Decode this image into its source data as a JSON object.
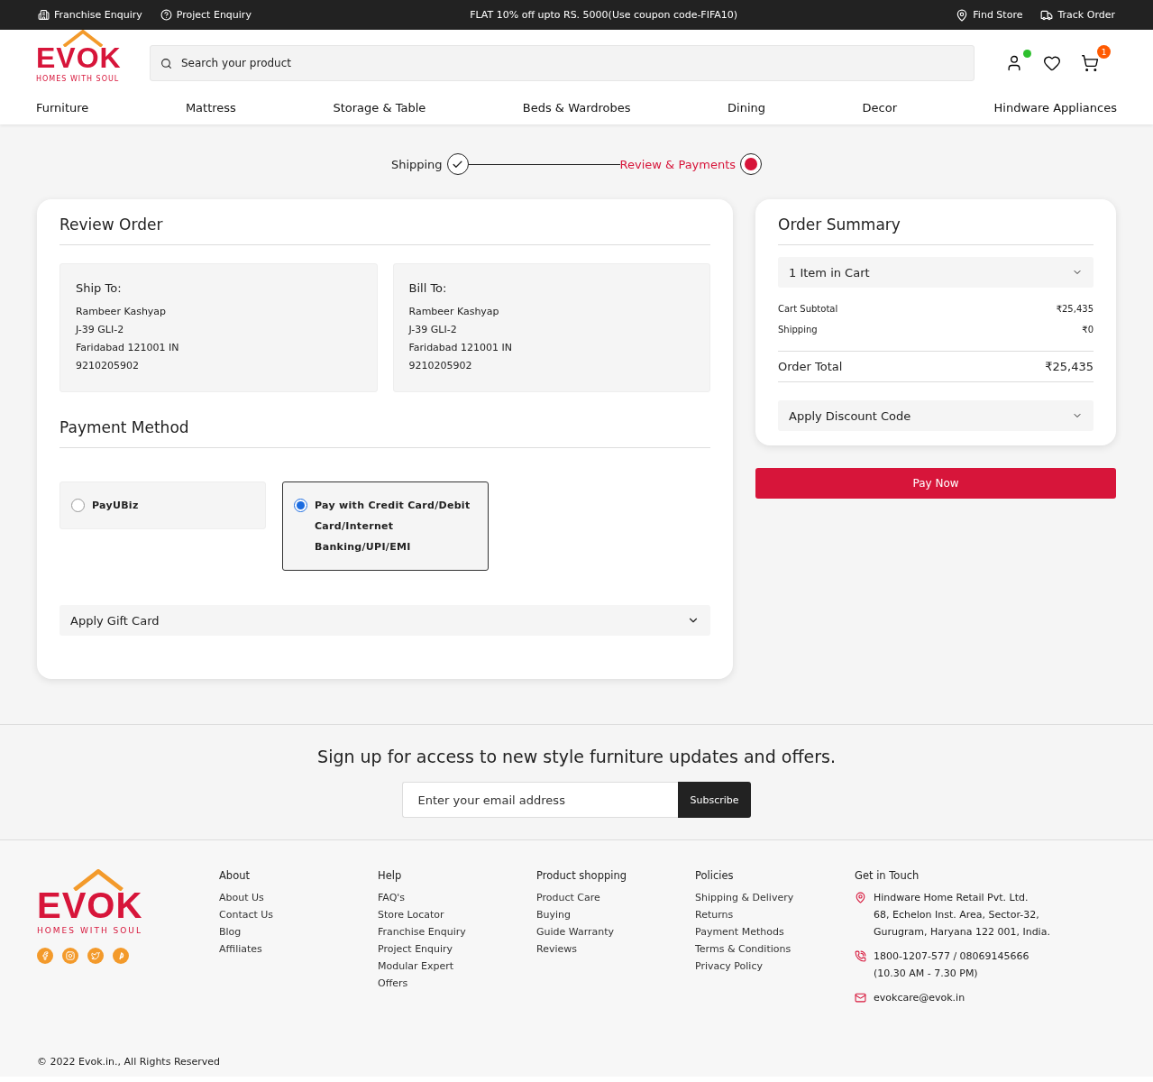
{
  "top_bar": {
    "left_links": [
      "Franchise Enquiry",
      "Project Enquiry"
    ],
    "promo": "FLAT 10% off upto RS. 5000(Use coupon code-FIFA10)",
    "right_links": [
      "Find Store",
      "Track Order"
    ]
  },
  "header": {
    "logo": {
      "name": "EVOK",
      "tagline": "HOMES WITH SOUL"
    },
    "search": {
      "placeholder": "Search your product"
    },
    "account_online": true,
    "cart_count": "1"
  },
  "nav": [
    "Furniture",
    "Mattress",
    "Storage & Table",
    "Beds & Wardrobes",
    "Dining",
    "Decor",
    "Hindware Appliances"
  ],
  "steps": [
    {
      "label": "Shipping",
      "done": true,
      "current": false
    },
    {
      "label": "Review & Payments",
      "done": false,
      "current": true
    }
  ],
  "review": {
    "title": "Review Order",
    "addresses": [
      {
        "title": "Ship To:",
        "lines": [
          "Rambeer Kashyap",
          "J-39 GLI-2",
          "Faridabad 121001 IN",
          "9210205902"
        ]
      },
      {
        "title": "Bill To:",
        "lines": [
          "Rambeer Kashyap",
          "J-39 GLI-2",
          "Faridabad 121001 IN",
          "9210205902"
        ]
      }
    ],
    "payment_title": "Payment Method",
    "payment_options": [
      {
        "label": "PayUBiz",
        "selected": false
      },
      {
        "label": "Pay with Credit Card/Debit Card/Internet Banking/UPI/EMI",
        "selected": true
      }
    ],
    "gift_card": {
      "label": "Apply Gift Card",
      "expanded": false
    }
  },
  "summary": {
    "title": "Order Summary",
    "cart_toggle": {
      "label": "1 Item in Cart",
      "expanded": false
    },
    "rows": [
      {
        "label": "Cart Subtotal",
        "value": "₹25,435"
      },
      {
        "label": "Shipping",
        "value": "₹0"
      }
    ],
    "total": {
      "label": "Order Total",
      "value": "₹25,435"
    },
    "discount": {
      "label": "Apply Discount Code",
      "expanded": false
    },
    "pay_button": "Pay Now"
  },
  "signup": {
    "title": "Sign up for access to new style furniture updates and offers.",
    "placeholder": "Enter your email address",
    "button": "Subscribe"
  },
  "footer": {
    "logo": {
      "name": "EVOK",
      "tagline": "HOMES WITH SOUL"
    },
    "columns": [
      {
        "title": "About",
        "links": [
          "About Us",
          "Contact Us",
          "Blog",
          "Affiliates"
        ]
      },
      {
        "title": "Help",
        "links": [
          "FAQ's",
          "Store Locator",
          "Franchise Enquiry",
          "Project Enquiry",
          "Modular Expert",
          "Offers"
        ]
      },
      {
        "title": "Product shopping",
        "links": [
          "Product Care",
          "Buying",
          "Guide Warranty",
          "Reviews"
        ]
      },
      {
        "title": "Policies",
        "links": [
          "Shipping & Delivery",
          "Returns",
          "Payment Methods",
          "Terms & Conditions",
          "Privacy Policy"
        ]
      }
    ],
    "contact": {
      "title": "Get in Touch",
      "items": [
        {
          "kind": "address",
          "lines": [
            "Hindware Home Retail Pvt. Ltd.",
            "68, Echelon Inst. Area, Sector-32,",
            "Gurugram, Haryana 122 001, India."
          ]
        },
        {
          "kind": "phone",
          "lines": [
            "1800-1207-577 / 08069145666",
            "(10.30 AM - 7.30 PM)"
          ]
        },
        {
          "kind": "email",
          "lines": [
            "evokcare@evok.in"
          ]
        }
      ]
    },
    "copyright": "© 2022 Evok.in., All Rights Reserved"
  }
}
